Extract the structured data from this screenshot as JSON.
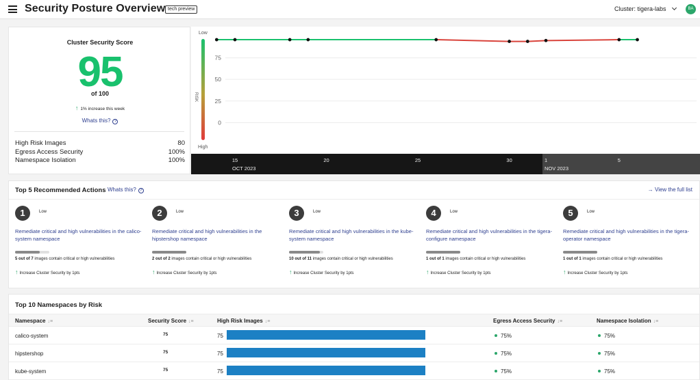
{
  "header": {
    "title": "Security Posture Overview",
    "badge": "tech preview",
    "cluster_label": "Cluster: tigera-labs",
    "avatar_initials": "BA",
    "accent_color": "#2ba66a"
  },
  "score_card": {
    "title": "Cluster Security Score",
    "score": "95",
    "of": "of 100",
    "trend": "1% increase this week",
    "whats_this": "Whats this?",
    "metrics": [
      {
        "label": "High Risk Images",
        "value": "80"
      },
      {
        "label": "Egress Access Security",
        "value": "100%"
      },
      {
        "label": "Namespace Isolation",
        "value": "100%"
      }
    ]
  },
  "chart_data": {
    "type": "line",
    "ylabel": "RISK",
    "y_top_label": "Low",
    "y_bottom_label": "High",
    "y_ticks": [
      "75",
      "50",
      "25",
      "0"
    ],
    "ylim": [
      -10,
      100
    ],
    "x_ticks": [
      {
        "label": "15",
        "sub": "OCT 2023"
      },
      {
        "label": "20",
        "sub": ""
      },
      {
        "label": "25",
        "sub": ""
      },
      {
        "label": "30",
        "sub": ""
      },
      {
        "label": "1",
        "sub": "NOV 2023"
      },
      {
        "label": "5",
        "sub": ""
      }
    ],
    "series": [
      {
        "points": [
          {
            "x": "2023-10-14",
            "y": 96
          },
          {
            "x": "2023-10-15",
            "y": 96
          },
          {
            "x": "2023-10-18",
            "y": 96
          },
          {
            "x": "2023-10-19",
            "y": 96
          },
          {
            "x": "2023-10-26",
            "y": 96
          },
          {
            "x": "2023-10-30",
            "y": 94
          },
          {
            "x": "2023-10-31",
            "y": 94
          },
          {
            "x": "2023-11-01",
            "y": 95
          },
          {
            "x": "2023-11-05",
            "y": 96
          },
          {
            "x": "2023-11-06",
            "y": 96
          }
        ]
      }
    ]
  },
  "actions": {
    "title": "Top 5 Recommended Actions",
    "whats_this": "Whats this?",
    "view_full_list": "View the full list",
    "items": [
      {
        "rank": "1",
        "severity": "Low",
        "title": "Remediate critical and high vulnerabilities in the calico-system namespace",
        "count": "5 out of 7",
        "stat_suffix": "images contain critical or high vulnerabilities",
        "fraction": 0.714,
        "increase": "Increase Cluster Security by 1pts"
      },
      {
        "rank": "2",
        "severity": "Low",
        "title": "Remediate critical and high vulnerabilities in the hipstershop namespace",
        "count": "2 out of 2",
        "stat_suffix": "images contain critical or high vulnerabilities",
        "fraction": 1.0,
        "increase": "Increase Cluster Security by 1pts"
      },
      {
        "rank": "3",
        "severity": "Low",
        "title": "Remediate critical and high vulnerabilities in the kube-system namespace",
        "count": "10 out of 11",
        "stat_suffix": "images contain critical or high vulnerabilities",
        "fraction": 0.909,
        "increase": "Increase Cluster Security by 1pts"
      },
      {
        "rank": "4",
        "severity": "Low",
        "title": "Remediate critical and high vulnerabilities in the tigera-configure namespace",
        "count": "1 out of 1",
        "stat_suffix": "images contain critical or high vulnerabilities",
        "fraction": 1.0,
        "increase": "Increase Cluster Security by 1pts"
      },
      {
        "rank": "5",
        "severity": "Low",
        "title": "Remediate critical and high vulnerabilities in the tigera-operator namespace",
        "count": "1 out of 1",
        "stat_suffix": "images contain critical or high vulnerabilities",
        "fraction": 1.0,
        "increase": "Increase Cluster Security by 1pts"
      }
    ]
  },
  "namespaces": {
    "title": "Top 10 Namespaces by Risk",
    "columns": [
      "Namespace",
      "Security Score",
      "High Risk Images",
      "Egress Access Security",
      "Namespace Isolation"
    ],
    "bar_color": "#1c80c4",
    "rows": [
      {
        "name": "calico-system",
        "score": "75",
        "high_risk": "75",
        "egress": "75%",
        "isolation": "75%"
      },
      {
        "name": "hipstershop",
        "score": "75",
        "high_risk": "75",
        "egress": "75%",
        "isolation": "75%"
      },
      {
        "name": "kube-system",
        "score": "75",
        "high_risk": "75",
        "egress": "75%",
        "isolation": "75%"
      }
    ]
  }
}
